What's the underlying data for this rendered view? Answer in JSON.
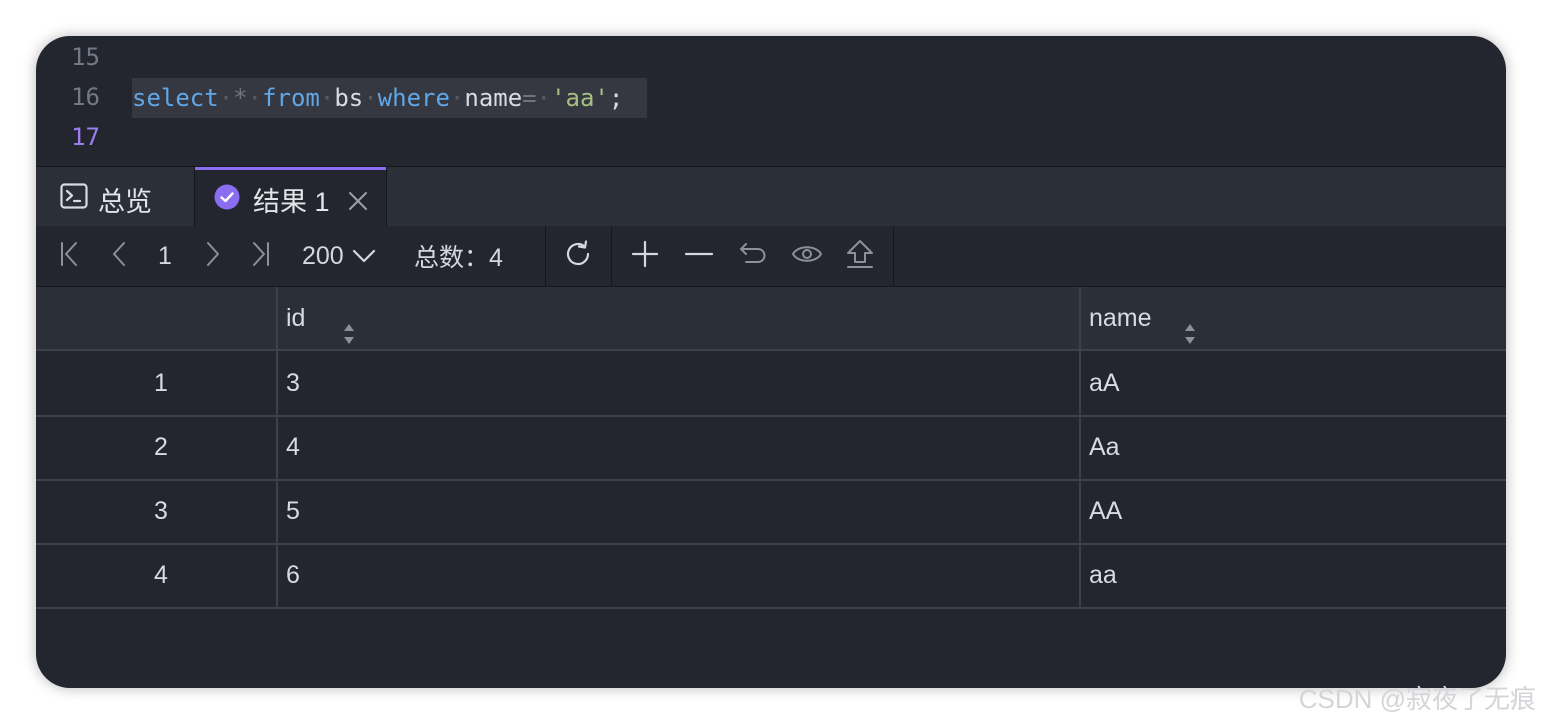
{
  "editor": {
    "lines": [
      {
        "number": "15"
      },
      {
        "number": "16",
        "tokens": {
          "select": "select",
          "star": "*",
          "from": "from",
          "table": "bs",
          "where": "where",
          "col": "name",
          "eq": "=",
          "str": "'aa'",
          "semi": ";"
        }
      },
      {
        "number": "17"
      }
    ]
  },
  "tabs": {
    "overview": {
      "label": "总览",
      "icon": "terminal-icon"
    },
    "result": {
      "label": "结果 1",
      "icon": "check-circle-icon",
      "close_icon": "close-icon",
      "active": true
    }
  },
  "toolbar": {
    "page": "1",
    "page_size": "200",
    "total_label": "总数：4",
    "icons": [
      "first-page-icon",
      "prev-page-icon",
      "next-page-icon",
      "last-page-icon",
      "chevron-down-icon",
      "refresh-icon",
      "add-row-icon",
      "delete-row-icon",
      "undo-icon",
      "preview-icon",
      "export-icon"
    ]
  },
  "grid": {
    "columns": [
      "id",
      "name"
    ],
    "rows": [
      {
        "num": "1",
        "id": "3",
        "name": "aA"
      },
      {
        "num": "2",
        "id": "4",
        "name": "Aa"
      },
      {
        "num": "3",
        "id": "5",
        "name": "AA"
      },
      {
        "num": "4",
        "id": "6",
        "name": "aa"
      }
    ]
  },
  "colors": {
    "accent": "#8a6df0",
    "keyword": "#61a6e6",
    "string": "#a7c080",
    "background": "#23262e"
  },
  "watermark": "CSDN @寂夜了无痕"
}
